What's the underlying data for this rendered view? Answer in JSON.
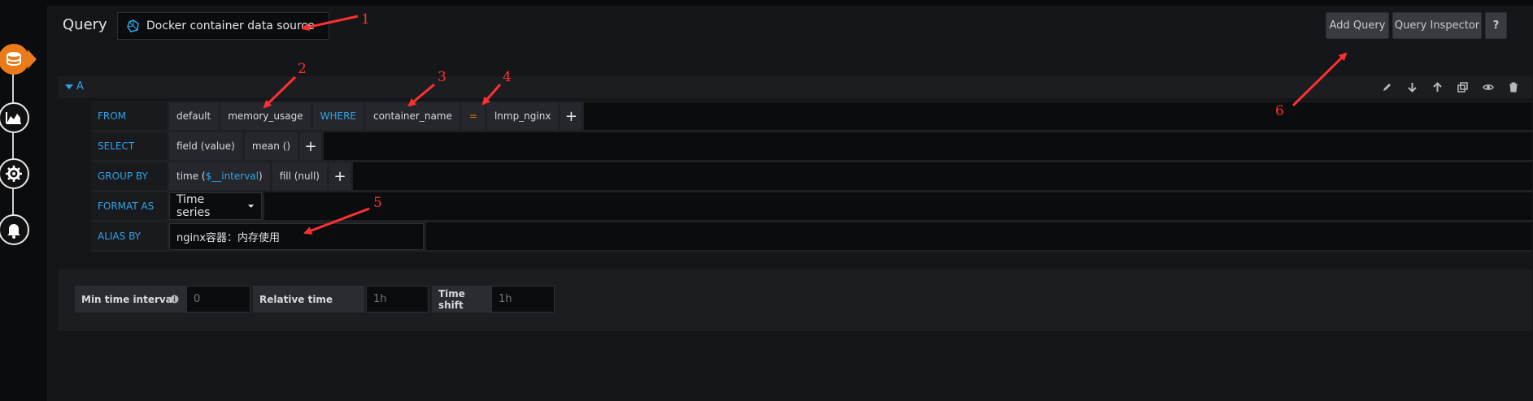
{
  "header": {
    "title": "Query",
    "datasource": "Docker container data source",
    "add_query": "Add Query",
    "query_inspector": "Query Inspector",
    "help": "?"
  },
  "query": {
    "ref_id": "A",
    "from": {
      "label": "FROM",
      "policy": "default",
      "measurement": "memory_usage",
      "where_label": "WHERE",
      "tag_key": "container_name",
      "operator": "=",
      "tag_value": "lnmp_nginx"
    },
    "select": {
      "label": "SELECT",
      "field": "field (value)",
      "func": "mean ()"
    },
    "group_by": {
      "label": "GROUP BY",
      "time_prefix": "time (",
      "time_var": "$__interval",
      "time_suffix": ")",
      "fill": "fill (null)"
    },
    "format_as": {
      "label": "FORMAT AS",
      "value": "Time series"
    },
    "alias_by": {
      "label": "ALIAS BY",
      "value": "nginx容器：内存使用"
    }
  },
  "options": {
    "min_interval_label": "Min time interval",
    "min_interval_placeholder": "0",
    "relative_time_label": "Relative time",
    "relative_time_placeholder": "1h",
    "time_shift_label": "Time shift",
    "time_shift_placeholder": "1h"
  },
  "annotations": [
    "1",
    "2",
    "3",
    "4",
    "5",
    "6"
  ],
  "colors": {
    "accent_blue": "#33a2e5",
    "accent_orange": "#eb7b18",
    "annotation_red": "#ff3030"
  }
}
